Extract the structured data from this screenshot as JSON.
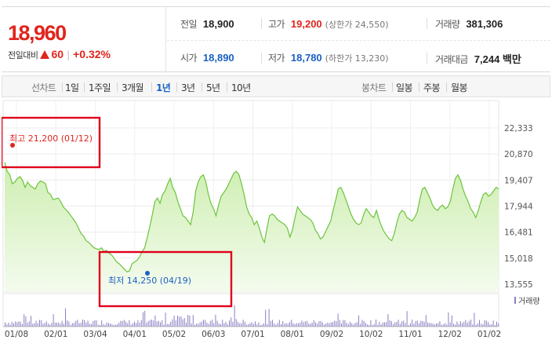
{
  "quote": {
    "price": "18,960",
    "change_label": "전일대비",
    "change_value": "60",
    "change_percent": "+0.32%",
    "up_color": "#e0251d",
    "down_color": "#1a61c4"
  },
  "stats": {
    "prev_close": {
      "label": "전일",
      "value": "18,900"
    },
    "high": {
      "label": "고가",
      "value": "19,200",
      "sub": "(상한가 24,550)"
    },
    "volume": {
      "label": "거래량",
      "value": "381,306"
    },
    "open": {
      "label": "시가",
      "value": "18,890"
    },
    "low": {
      "label": "저가",
      "value": "18,780",
      "sub": "(하한가 13,230)"
    },
    "amount": {
      "label": "거래대금",
      "value": "7,244 백만"
    }
  },
  "line_periods": {
    "label": "선차트",
    "items": [
      "1일",
      "1주일",
      "3개월",
      "1년",
      "3년",
      "5년",
      "10년"
    ],
    "selected": "1년"
  },
  "candle_periods": {
    "label": "봉차트",
    "items": [
      "일봉",
      "주봉",
      "월봉"
    ]
  },
  "chart_data": {
    "type": "area",
    "period": "1년",
    "y_ticks": [
      "22,333",
      "20,870",
      "19,407",
      "17,944",
      "16,481",
      "15,018",
      "13,555"
    ],
    "ylim": [
      13555,
      22333
    ],
    "x_ticks": [
      "01/08",
      "02/01",
      "03/04",
      "04/01",
      "05/02",
      "06/03",
      "07/01",
      "08/01",
      "09/02",
      "10/02",
      "11/01",
      "12/02",
      "01/02"
    ],
    "series": [
      {
        "values": [
          20400,
          19900,
          19700,
          19200,
          19300,
          19500,
          19600,
          19400,
          19000,
          19300,
          19100,
          19000,
          18900,
          19200,
          19350,
          19300,
          19200,
          18700,
          18600,
          18300,
          18350,
          18400,
          18200,
          17900,
          17750,
          17600,
          17400,
          17200,
          17000,
          16700,
          16400,
          16250,
          16000,
          15900,
          15750,
          15600,
          15550,
          15500,
          15600,
          15400,
          15450,
          15300,
          15200,
          15000,
          14800,
          14700,
          14550,
          14400,
          14250,
          14300,
          14700,
          14800,
          14900,
          15100,
          15400,
          15600,
          16200,
          16800,
          17500,
          18200,
          18400,
          18100,
          18600,
          18800,
          19200,
          19500,
          19000,
          18700,
          18200,
          17800,
          17400,
          17300,
          17100,
          16900,
          17600,
          18800,
          19300,
          19600,
          19700,
          19300,
          18600,
          18100,
          17800,
          17400,
          18000,
          18500,
          18700,
          18900,
          19200,
          19500,
          19800,
          19900,
          19700,
          19200,
          18600,
          17900,
          17500,
          17300,
          16900,
          17100,
          16700,
          16200,
          15900,
          16700,
          17400,
          17500,
          17400,
          17200,
          17100,
          17000,
          16900,
          16700,
          16200,
          16600,
          17300,
          17900,
          17700,
          17500,
          17400,
          17300,
          17200,
          17000,
          16600,
          16400,
          16100,
          16200,
          16500,
          16800,
          17100,
          17700,
          18300,
          18900,
          19000,
          18700,
          18300,
          17900,
          17500,
          17200,
          17000,
          16900,
          17000,
          17500,
          17800,
          17600,
          17400,
          17300,
          17700,
          17200,
          16800,
          16500,
          16300,
          16100,
          16000,
          16400,
          17000,
          17500,
          17700,
          17600,
          17300,
          17200,
          17100,
          17300,
          17600,
          18300,
          18900,
          19000,
          18700,
          18400,
          18000,
          17800,
          17700,
          17900,
          18000,
          17800,
          17900,
          18200,
          18900,
          19500,
          19700,
          19400,
          18900,
          18500,
          18200,
          17800,
          17600,
          17300,
          17700,
          18200,
          18600,
          18700,
          18500,
          18600,
          18800,
          19000,
          18900
        ]
      }
    ],
    "high_marker": {
      "label": "최고",
      "value": "21,200",
      "date": "(01/12)"
    },
    "low_marker": {
      "label": "최저",
      "value": "14,250",
      "date": "(04/19)"
    },
    "volume_legend": "거래량",
    "line_color": "#6cc43b",
    "fill_color": "#d9f3c3",
    "volume_color": "#8a7fc4",
    "marker_box_color": "#e0001c"
  }
}
